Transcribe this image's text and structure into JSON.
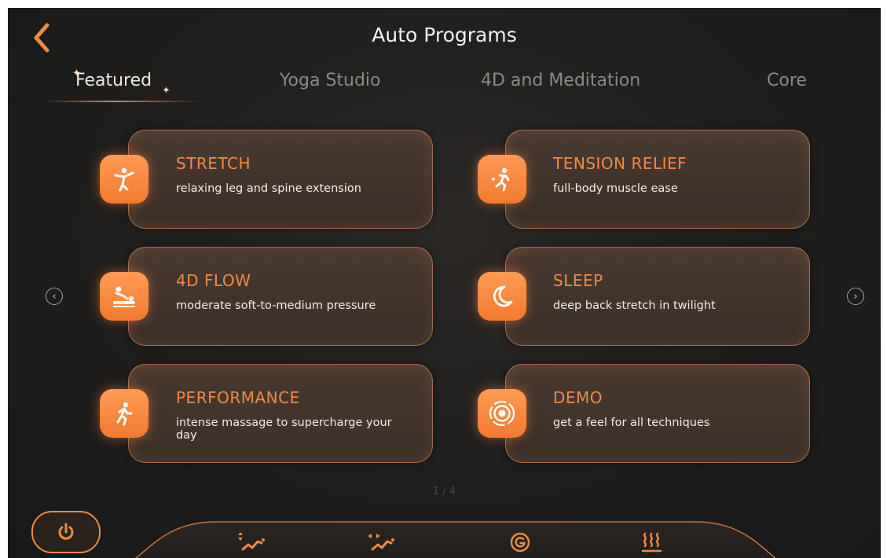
{
  "header": {
    "title": "Auto Programs"
  },
  "tabs": [
    {
      "label": "Featured",
      "active": true
    },
    {
      "label": "Yoga Studio",
      "active": false
    },
    {
      "label": "4D and Meditation",
      "active": false
    },
    {
      "label": "Core",
      "active": false
    }
  ],
  "programs": [
    {
      "title": "STRETCH",
      "description": "relaxing leg and spine extension",
      "icon": "yoga-pose-icon"
    },
    {
      "title": "TENSION RELIEF",
      "description": "full-body muscle ease",
      "icon": "sparkle-runner-icon"
    },
    {
      "title": "4D FLOW",
      "description": "moderate soft-to-medium pressure",
      "icon": "massage-icon"
    },
    {
      "title": "SLEEP",
      "description": "deep back stretch in twilight",
      "icon": "moon-icon"
    },
    {
      "title": "PERFORMANCE",
      "description": "intense massage to supercharge your day",
      "icon": "runner-icon"
    },
    {
      "title": "DEMO",
      "description": "get a feel for all techniques",
      "icon": "target-icon"
    }
  ],
  "pagination": {
    "text": "1 / 4"
  },
  "colors": {
    "accent": "#f08a45",
    "background": "#1f1e1d",
    "card": "#3f3229"
  },
  "dock": {
    "buttons": [
      "vertical-wave-icon",
      "horizontal-wave-icon",
      "g-circle-icon",
      "heat-icon"
    ],
    "power_icon": "power-icon"
  }
}
